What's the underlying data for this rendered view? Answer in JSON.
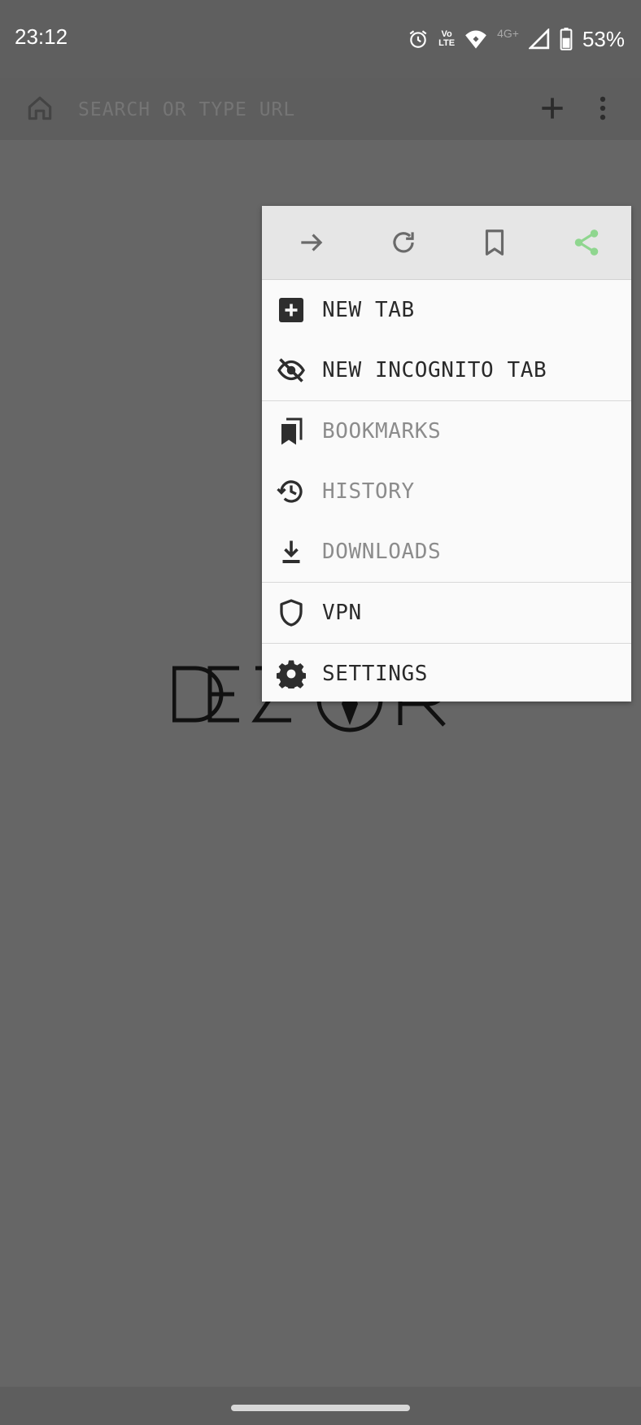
{
  "status_bar": {
    "time": "23:12",
    "network_label": "4G+",
    "volte_top": "Vo",
    "volte_bottom": "LTE",
    "battery_percent": "53%",
    "icons": [
      "alarm-icon",
      "volte-icon",
      "wifi-icon",
      "signal-icon",
      "battery-icon"
    ]
  },
  "toolbar": {
    "home_icon": "home-icon",
    "search_placeholder": "SEARCH OR TYPE URL",
    "new_tab_icon": "plus-icon",
    "menu_icon": "more-vertical-icon"
  },
  "menu": {
    "top_actions": [
      "forward-icon",
      "refresh-icon",
      "bookmark-icon",
      "share-icon"
    ],
    "share_color": "#8fd68f",
    "items": [
      {
        "label": "NEW TAB",
        "icon": "add-box-icon",
        "enabled": true
      },
      {
        "label": "NEW INCOGNITO TAB",
        "icon": "eye-off-icon",
        "enabled": true
      },
      {
        "label": "BOOKMARKS",
        "icon": "bookmarks-icon",
        "enabled": false
      },
      {
        "label": "HISTORY",
        "icon": "history-icon",
        "enabled": false
      },
      {
        "label": "DOWNLOADS",
        "icon": "download-icon",
        "enabled": false
      },
      {
        "label": "VPN",
        "icon": "shield-icon",
        "enabled": true
      },
      {
        "label": "SETTINGS",
        "icon": "gear-icon",
        "enabled": true
      }
    ]
  },
  "logo": {
    "text": "DEZOR"
  }
}
